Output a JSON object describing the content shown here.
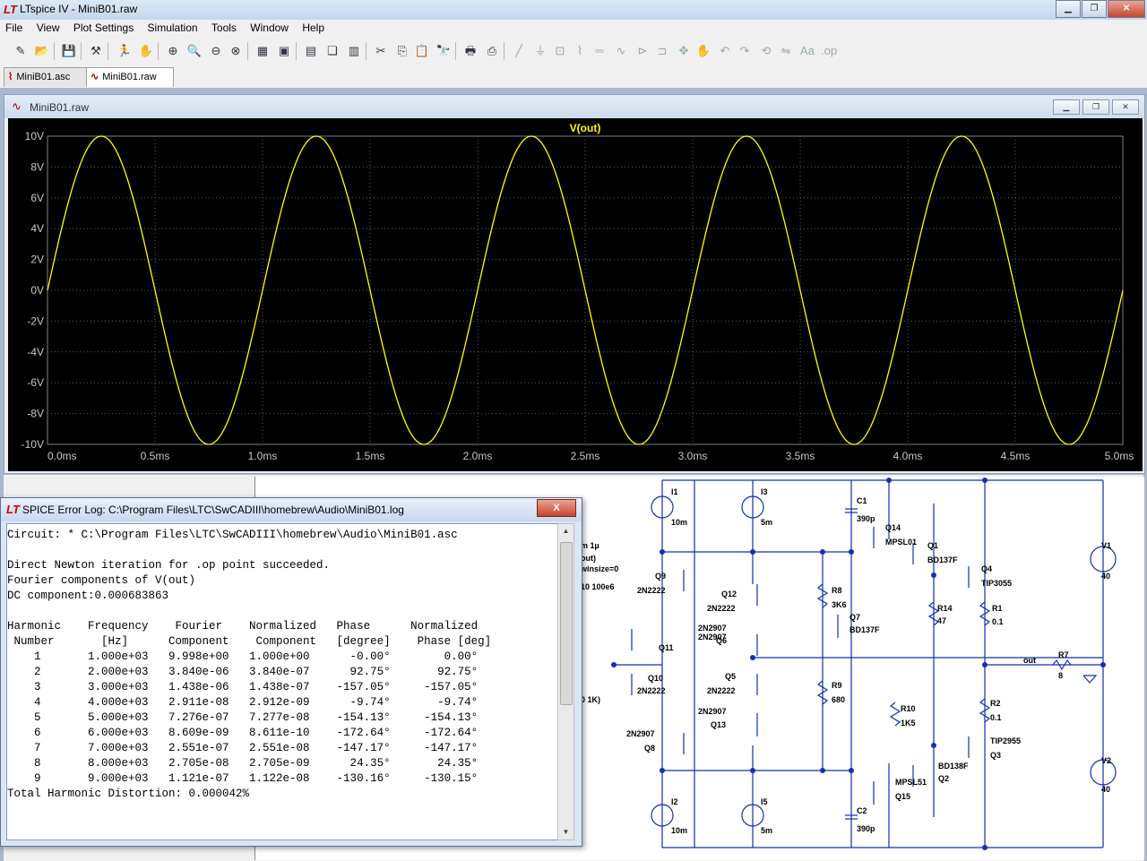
{
  "app": {
    "title": "LTspice IV - MiniB01.raw"
  },
  "menu": [
    "File",
    "View",
    "Plot Settings",
    "Simulation",
    "Tools",
    "Window",
    "Help"
  ],
  "tabs": [
    {
      "label": "MiniB01.asc",
      "active": false
    },
    {
      "label": "MiniB01.raw",
      "active": true
    }
  ],
  "plot_window": {
    "title": "MiniB01.raw"
  },
  "chart_data": {
    "type": "line",
    "title": "V(out)",
    "series": [
      {
        "name": "V(out)",
        "color": "#ffff00",
        "function": "sine",
        "amplitude_V": 10,
        "frequency_Hz": 1000
      }
    ],
    "xlim": [
      0,
      5
    ],
    "ylim": [
      -10,
      10
    ],
    "x_tick_labels": [
      "0.0ms",
      "0.5ms",
      "1.0ms",
      "1.5ms",
      "2.0ms",
      "2.5ms",
      "3.0ms",
      "3.5ms",
      "4.0ms",
      "4.5ms",
      "5.0ms"
    ],
    "y_tick_labels": [
      "10V",
      "8V",
      "6V",
      "4V",
      "2V",
      "0V",
      "-2V",
      "-4V",
      "-6V",
      "-8V",
      "-10V"
    ],
    "grid": true,
    "background": "#000000"
  },
  "log_window": {
    "title": "SPICE Error Log: C:\\Program Files\\LTC\\SwCADIII\\homebrew\\Audio\\MiniB01.log",
    "close_label": "X",
    "lines": [
      "Circuit: * C:\\Program Files\\LTC\\SwCADIII\\homebrew\\Audio\\MiniB01.asc",
      "",
      "Direct Newton iteration for .op point succeeded.",
      "Fourier components of V(out)",
      "DC component:0.000683863",
      "",
      "Harmonic    Frequency    Fourier    Normalized   Phase      Normalized",
      " Number       [Hz]      Component    Component   [degree]    Phase [deg]",
      "    1       1.000e+03   9.998e+00   1.000e+00      -0.00°        0.00°",
      "    2       2.000e+03   3.840e-06   3.840e-07      92.75°       92.75°",
      "    3       3.000e+03   1.438e-06   1.438e-07    -157.05°     -157.05°",
      "    4       4.000e+03   2.911e-08   2.912e-09      -9.74°       -9.74°",
      "    5       5.000e+03   7.276e-07   7.277e-08    -154.13°     -154.13°",
      "    6       6.000e+03   8.609e-09   8.611e-10    -172.64°     -172.64°",
      "    7       7.000e+03   2.551e-07   2.551e-08    -147.17°     -147.17°",
      "    8       8.000e+03   2.705e-08   2.705e-09      24.35°       24.35°",
      "    9       9.000e+03   1.121e-07   1.122e-08    -130.16°     -130.15°",
      "Total Harmonic Distortion: 0.000042%"
    ]
  },
  "schematic": {
    "labels": [
      "I1",
      "10m",
      "I3",
      "5m",
      "C1",
      "390p",
      "Q14",
      "MPSL01",
      "Q1",
      "BD137F",
      "Q4",
      "TIP3055",
      "R1",
      "0.1",
      "V1",
      "40",
      "Q9",
      "2N2222",
      "Q12",
      "2N2222",
      "2N2907",
      "Q6",
      "2N2907",
      "Q11",
      "R8",
      "3K6",
      "Q7",
      "BD137F",
      "R14",
      "47",
      "Q10",
      "2N2222",
      "Q5",
      "2N2222",
      "out",
      "R7",
      "8",
      "R9",
      "680",
      "R10",
      "1K5",
      "R2",
      "0.1",
      "2N2907",
      "Q13",
      "2N2907",
      "Q8",
      "TIP2955",
      "Q3",
      "BD138F",
      "Q2",
      "MPSL51",
      "Q15",
      "V2",
      "40",
      "I2",
      "10m",
      "I5",
      "5m",
      "C2",
      "390p",
      "m 1µ",
      "out)",
      "winsize=0",
      "10 100e6",
      "0 1K)"
    ]
  }
}
